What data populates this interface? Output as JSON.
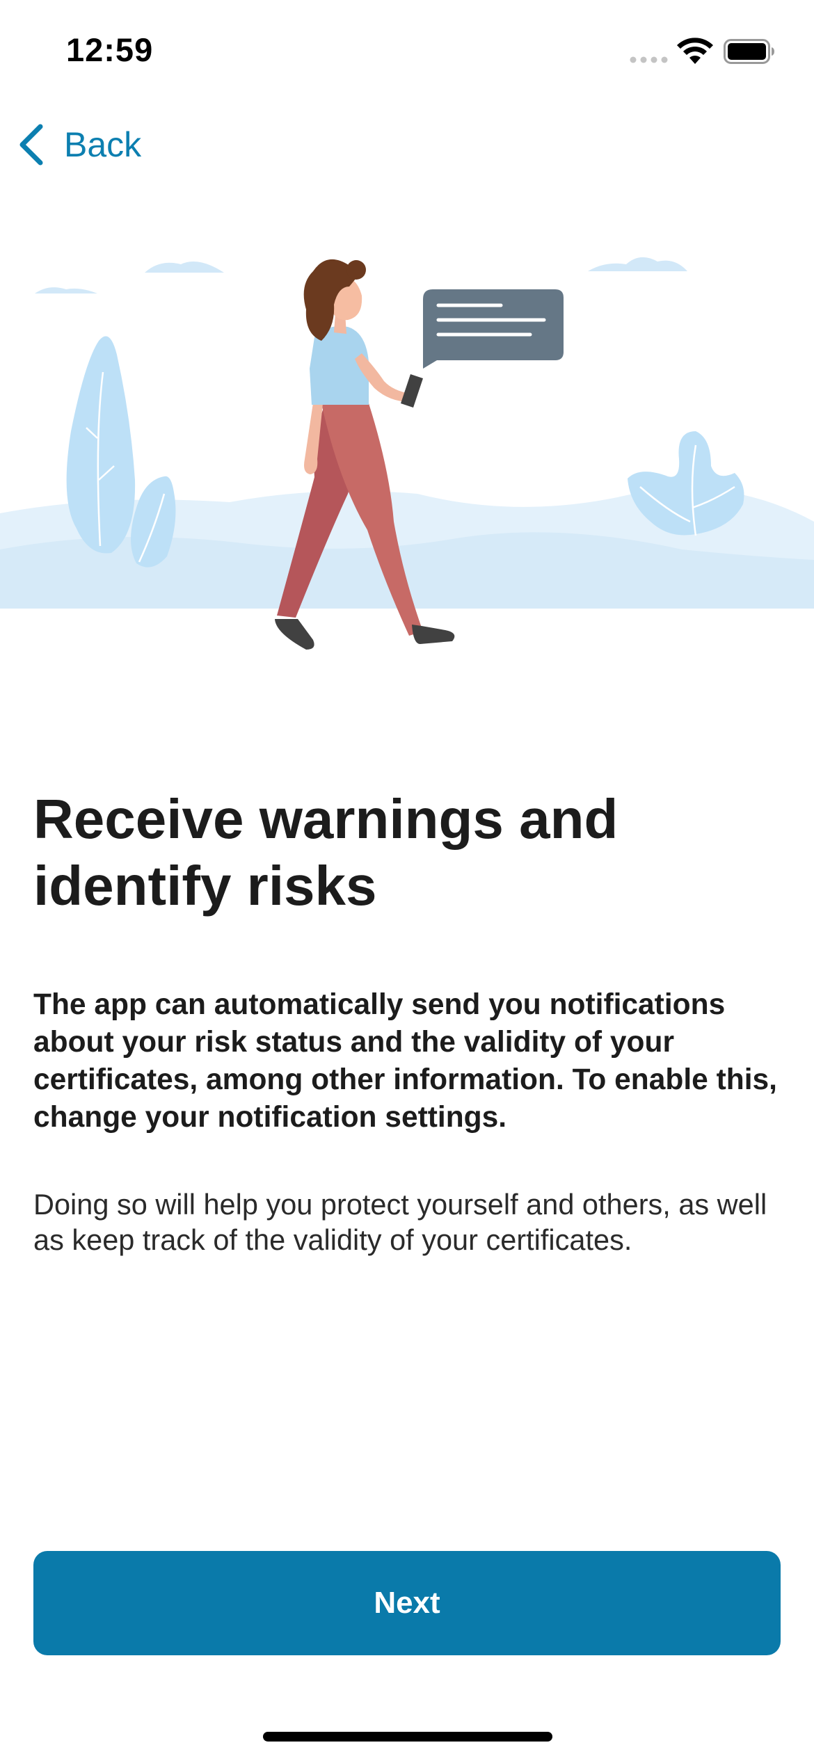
{
  "status_bar": {
    "time": "12:59"
  },
  "navigation": {
    "back_label": "Back"
  },
  "content": {
    "headline": "Receive warnings and identify risks",
    "intro": "The app can automatically send you notifications about your risk status and the validity of your certificates, among other information. To enable this, change your notification settings.",
    "detail": "Doing so will help you protect yourself and others, as well as keep track of the validity of your certificates."
  },
  "actions": {
    "next_label": "Next"
  },
  "colors": {
    "accent": "#0a7aaa",
    "link": "#0c7fb0",
    "text": "#1c1c1c",
    "illustration_light_blue": "#bde0f7",
    "illustration_pale_blue": "#e3f1fb",
    "speech_bubble": "#657786"
  },
  "icons": {
    "back": "chevron-left-icon",
    "signal": "cellular-signal-icon",
    "wifi": "wifi-icon",
    "battery": "battery-icon"
  }
}
